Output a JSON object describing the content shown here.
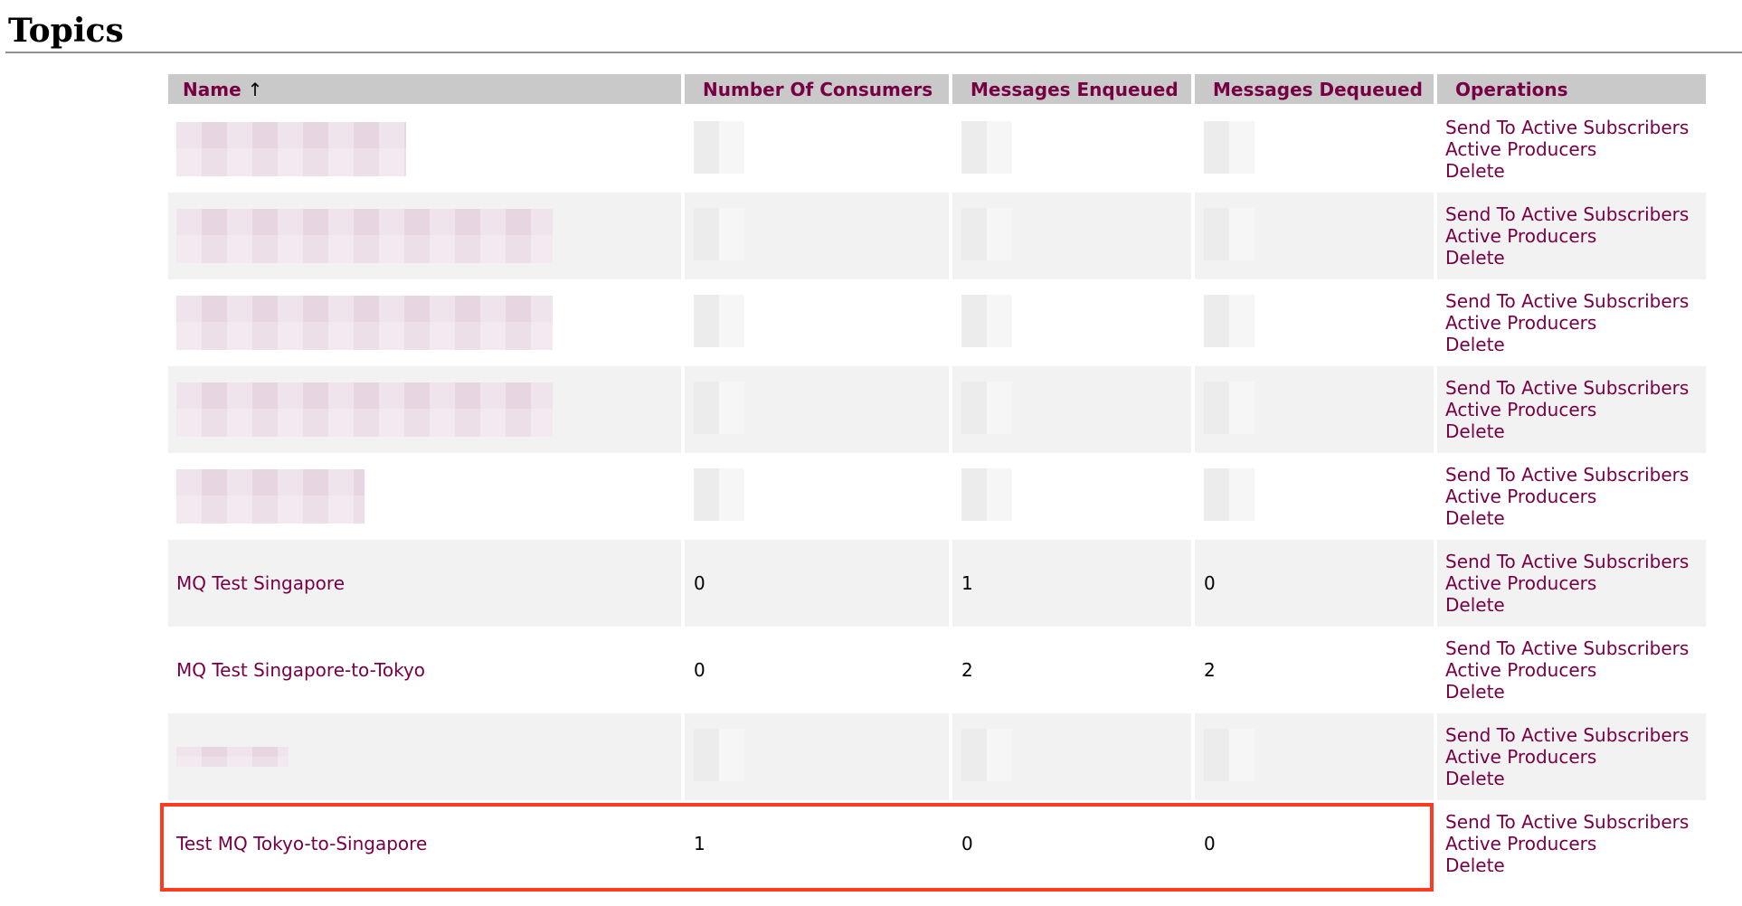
{
  "page": {
    "title": "Topics"
  },
  "table": {
    "columns": {
      "name": "Name",
      "sort_indicator": "↑",
      "consumers": "Number Of Consumers",
      "enqueued": "Messages Enqueued",
      "dequeued": "Messages Dequeued",
      "operations": "Operations"
    },
    "operations": {
      "send": "Send To Active Subscribers",
      "producers": "Active Producers",
      "delete": "Delete"
    },
    "rows": [
      {
        "redacted": true,
        "name": "",
        "consumers": "",
        "enqueued": "",
        "dequeued": ""
      },
      {
        "redacted": true,
        "name": "",
        "consumers": "",
        "enqueued": "",
        "dequeued": ""
      },
      {
        "redacted": true,
        "name": "",
        "consumers": "",
        "enqueued": "",
        "dequeued": ""
      },
      {
        "redacted": true,
        "name": "",
        "consumers": "",
        "enqueued": "",
        "dequeued": ""
      },
      {
        "redacted": true,
        "name": "",
        "consumers": "",
        "enqueued": "",
        "dequeued": ""
      },
      {
        "redacted": false,
        "name": "MQ Test Singapore",
        "consumers": "0",
        "enqueued": "1",
        "dequeued": "0"
      },
      {
        "redacted": false,
        "name": "MQ Test Singapore-to-Tokyo",
        "consumers": "0",
        "enqueued": "2",
        "dequeued": "2"
      },
      {
        "redacted": true,
        "name": "",
        "consumers": "",
        "enqueued": "",
        "dequeued": ""
      },
      {
        "redacted": false,
        "name": "Test MQ Tokyo-to-Singapore",
        "consumers": "1",
        "enqueued": "0",
        "dequeued": "0",
        "highlighted": true
      }
    ]
  },
  "colors": {
    "link": "#770044",
    "header_bg": "#c9c9c9",
    "highlight": "#ff3b1f"
  }
}
